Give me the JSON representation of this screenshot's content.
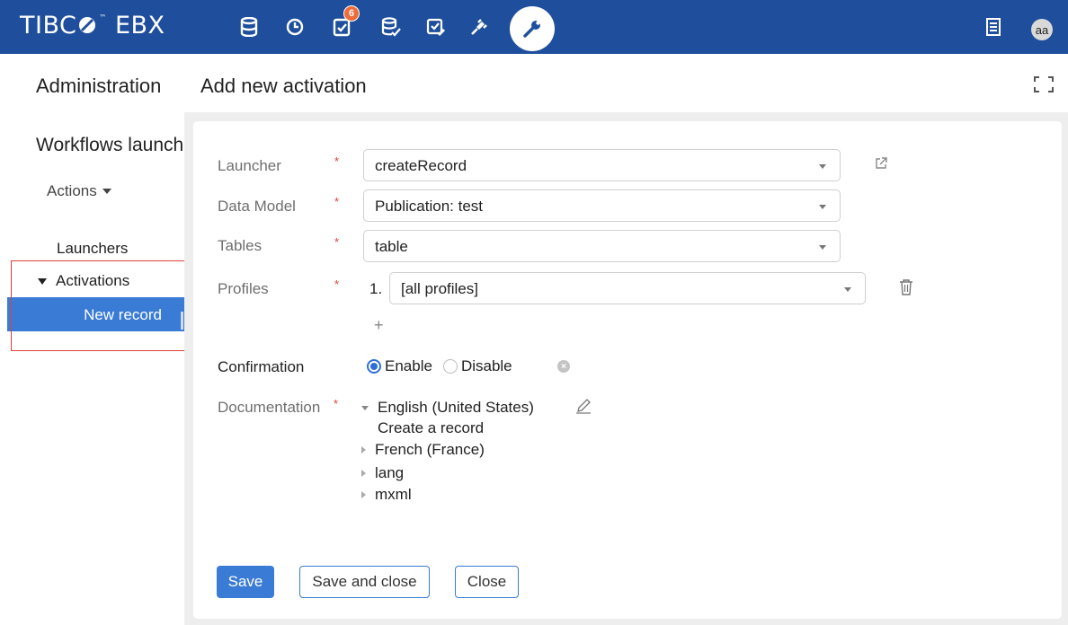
{
  "app": {
    "logo_text": "TIBC",
    "logo_text2": "EBX",
    "logo_tm": "™",
    "notification_count": "6",
    "avatar_initials": "aa"
  },
  "header": {
    "section": "Administration",
    "title": "Add new activation"
  },
  "sidebar": {
    "title": "Workflows launchers",
    "actions_label": "Actions",
    "items": [
      {
        "label": "Launchers"
      },
      {
        "label": "Activations"
      },
      {
        "label": "New record"
      }
    ]
  },
  "form": {
    "launcher": {
      "label": "Launcher",
      "value": "createRecord"
    },
    "data_model": {
      "label": "Data Model",
      "value": "Publication: test"
    },
    "tables": {
      "label": "Tables",
      "value": "table"
    },
    "profiles": {
      "label": "Profiles",
      "index": "1.",
      "value": "[all profiles]",
      "add_symbol": "+"
    },
    "required_mark": "*",
    "confirmation": {
      "label": "Confirmation",
      "option_enable": "Enable",
      "option_disable": "Disable",
      "selected": "Enable"
    },
    "documentation": {
      "label": "Documentation",
      "languages": [
        {
          "name": "English (United States)",
          "expanded": true,
          "text": "Create a record"
        },
        {
          "name": "French (France)",
          "expanded": false
        },
        {
          "name": "lang",
          "expanded": false
        },
        {
          "name": "mxml",
          "expanded": false
        }
      ]
    }
  },
  "buttons": {
    "save": "Save",
    "save_and_close": "Save and close",
    "close": "Close"
  },
  "colors": {
    "topbar": "#1f4f9c",
    "accent": "#3a7bd5",
    "required": "#e0403a",
    "badge": "#ee6b3a"
  },
  "icons": [
    "database-icon",
    "clock-icon",
    "task-check-icon",
    "data-service-icon",
    "checklist-icon",
    "plug-icon",
    "wrench-icon",
    "list-view-icon",
    "fullscreen-icon",
    "external-link-icon",
    "trash-icon",
    "clear-icon",
    "pencil-icon"
  ]
}
